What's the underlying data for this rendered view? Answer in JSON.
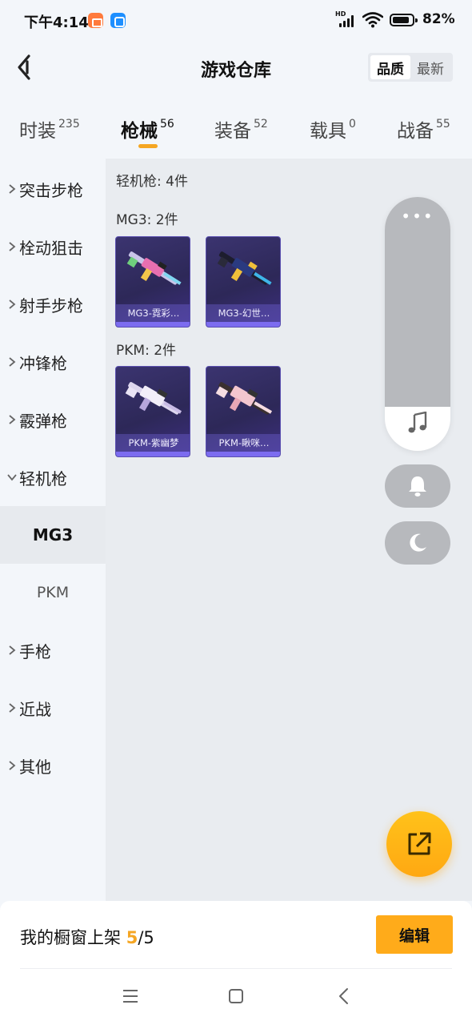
{
  "status_bar": {
    "time": "下午4:14",
    "network_tag": "HD",
    "battery": "82%"
  },
  "header": {
    "title": "游戏仓库",
    "sort_options": [
      "品质",
      "最新"
    ],
    "sort_active": "品质"
  },
  "tabs": [
    {
      "label": "时装",
      "count": "235"
    },
    {
      "label": "枪械",
      "count": "56",
      "active": true
    },
    {
      "label": "装备",
      "count": "52"
    },
    {
      "label": "载具",
      "count": "0"
    },
    {
      "label": "战备",
      "count": "55"
    }
  ],
  "sidebar": {
    "items": [
      {
        "label": "突击步枪"
      },
      {
        "label": "栓动狙击"
      },
      {
        "label": "射手步枪"
      },
      {
        "label": "冲锋枪"
      },
      {
        "label": "霰弹枪"
      },
      {
        "label": "轻机枪",
        "expanded": true
      },
      {
        "label": "手枪"
      },
      {
        "label": "近战"
      },
      {
        "label": "其他"
      }
    ],
    "subitems": [
      {
        "label": "MG3",
        "selected": true
      },
      {
        "label": "PKM"
      }
    ]
  },
  "content": {
    "category_summary": "轻机枪: 4件",
    "groups": [
      {
        "heading": "MG3: 2件",
        "items": [
          {
            "name": "MG3-霓彩…"
          },
          {
            "name": "MG3-幻世…"
          }
        ]
      },
      {
        "heading": "PKM: 2件",
        "items": [
          {
            "name": "PKM-紫幽梦"
          },
          {
            "name": "PKM-瞅咪…"
          }
        ]
      }
    ]
  },
  "float_panel": {
    "menu_glyph": "•••",
    "music_icon": "music-note-icon",
    "bell_icon": "bell-icon",
    "moon_icon": "moon-icon"
  },
  "bottom_bar": {
    "showcase_label": "我的橱窗上架 ",
    "showcase_count": "5",
    "showcase_total": "/5",
    "edit_label": "编辑"
  },
  "colors": {
    "accent": "#f5a623",
    "fab": "#ffab1a",
    "card_bg": "#2d2858",
    "card_bar": "#7c6cf0"
  }
}
